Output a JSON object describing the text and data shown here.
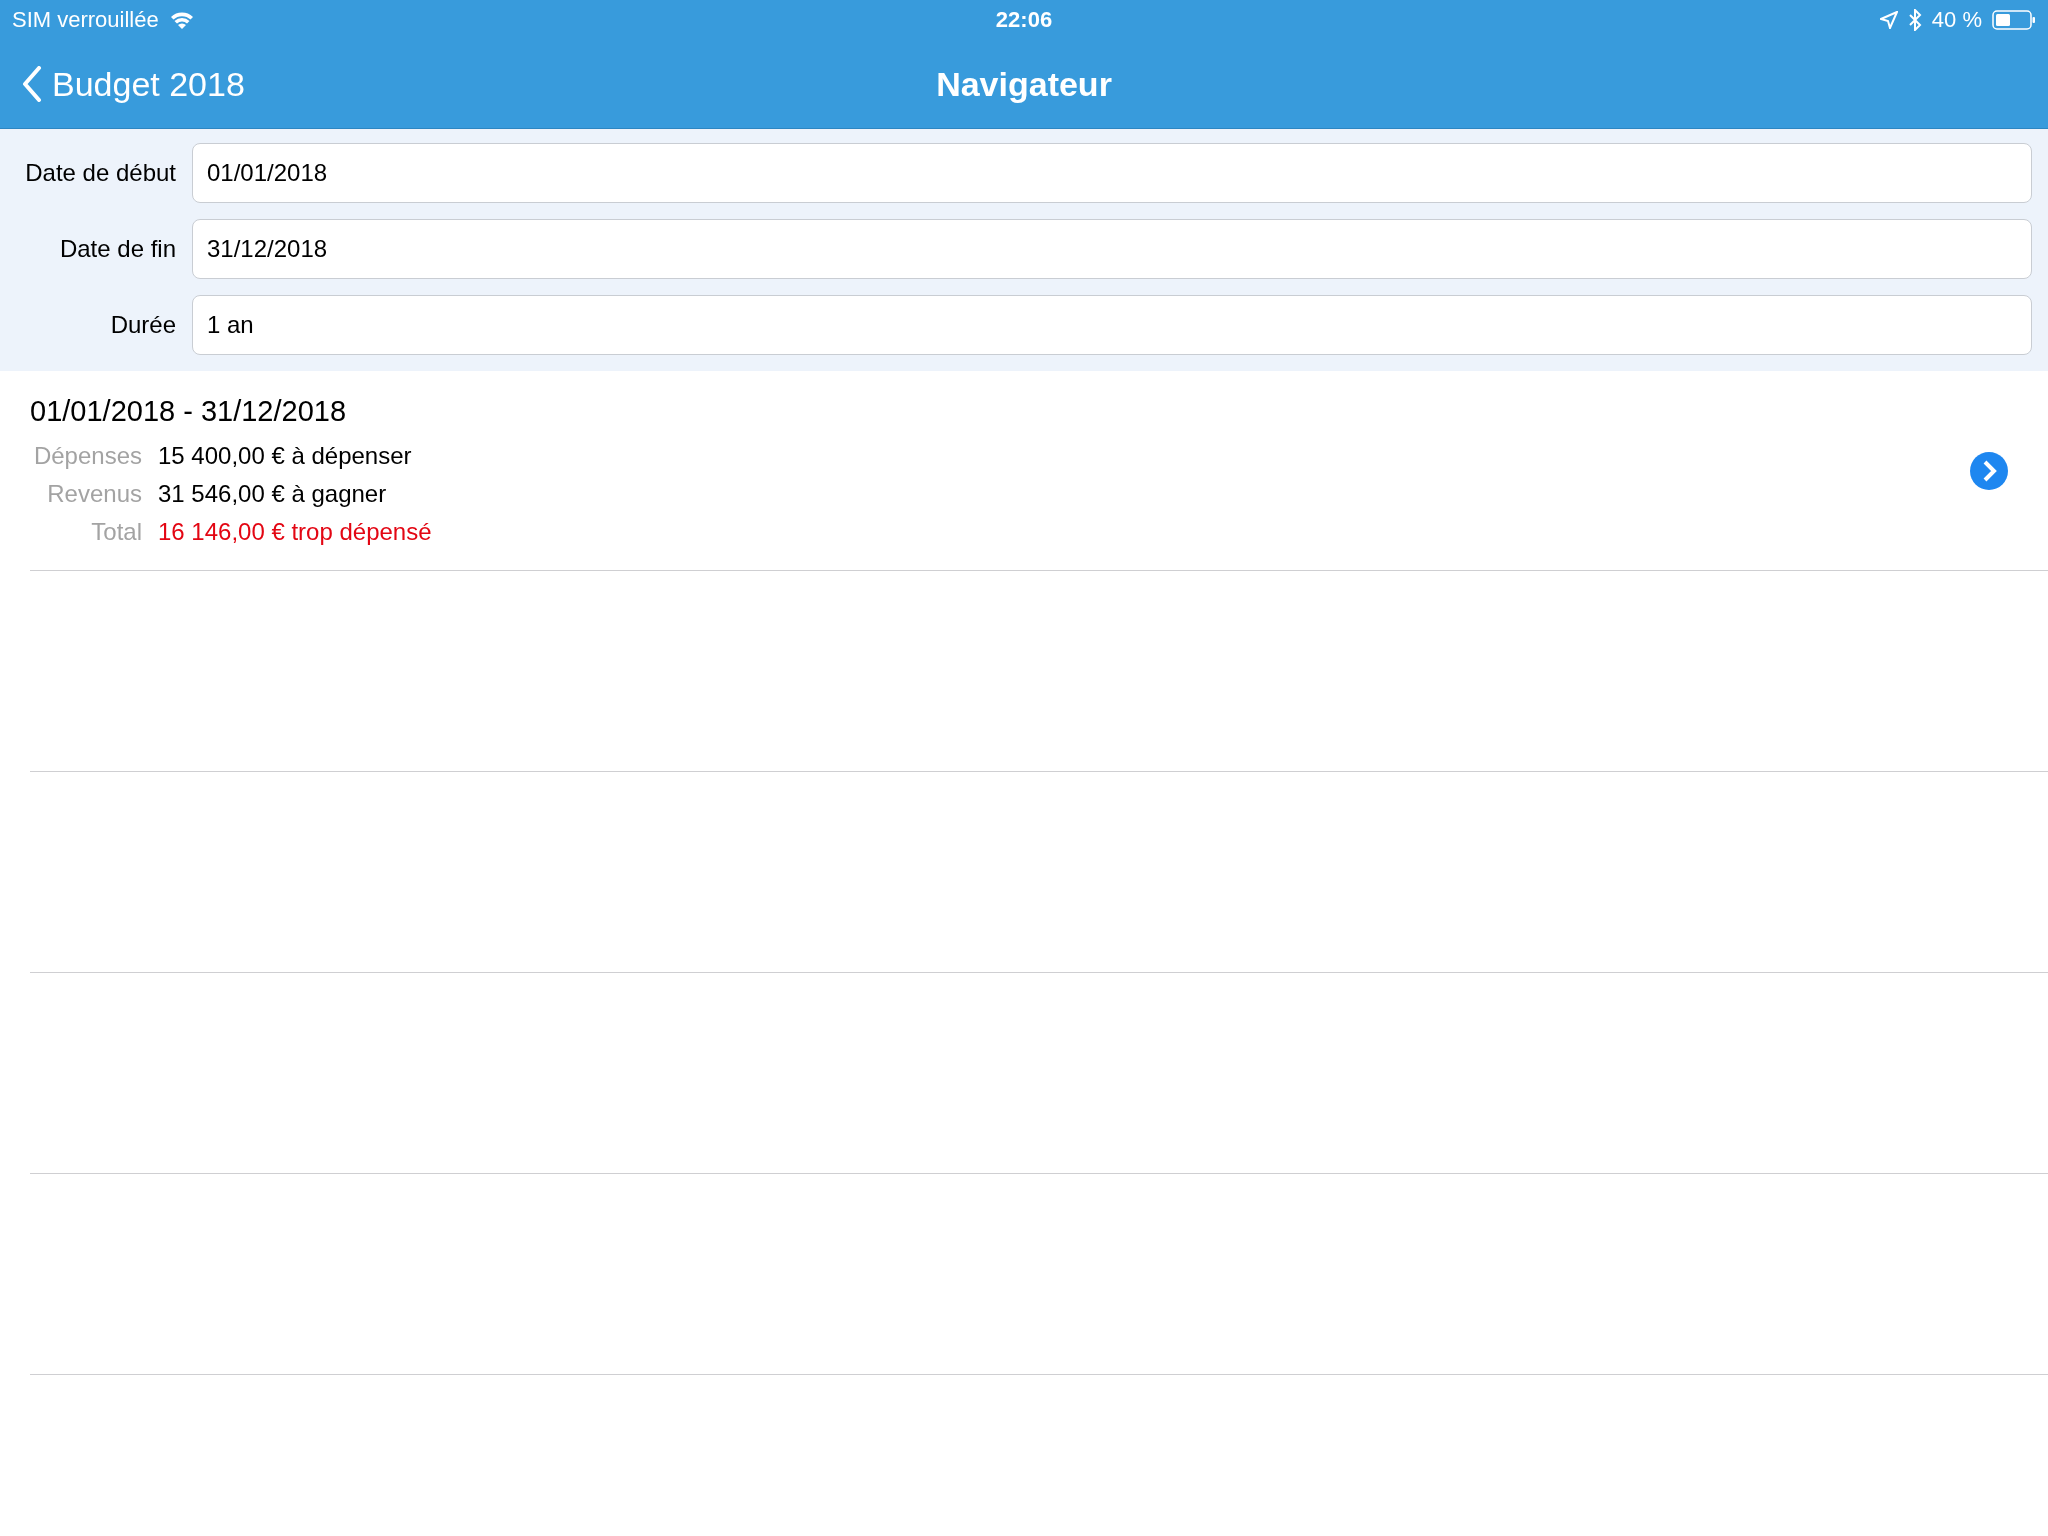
{
  "status_bar": {
    "carrier": "SIM verrouillée",
    "time": "22:06",
    "battery": "40 %"
  },
  "nav_bar": {
    "back": "Budget 2018",
    "title": "Navigateur"
  },
  "form": {
    "fields": [
      {
        "label": "Date de début",
        "value": "01/01/2018"
      },
      {
        "label": "Date de fin",
        "value": "31/12/2018"
      },
      {
        "label": "Durée",
        "value": "1 an"
      }
    ]
  },
  "periods": [
    {
      "title": "01/01/2018 - 31/12/2018",
      "lines": [
        {
          "label": "Dépenses",
          "value": "15 400,00 € à dépenser",
          "kind": "normal"
        },
        {
          "label": "Revenus",
          "value": "31 546,00 € à gagner",
          "kind": "normal"
        },
        {
          "label": "Total",
          "value": "16 146,00 € trop dépensé",
          "kind": "negative"
        }
      ]
    }
  ]
}
